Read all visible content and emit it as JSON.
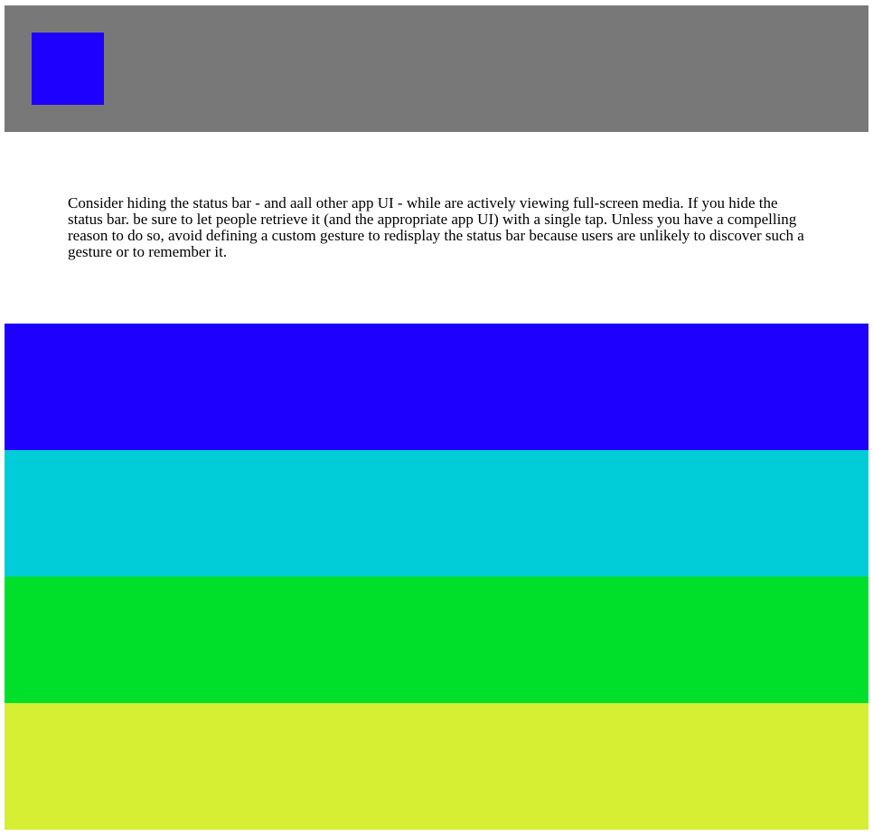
{
  "header": {
    "logo_color": "#1e00ff",
    "background_color": "#787878"
  },
  "content": {
    "paragraph": "Consider hiding the status bar - and aall other app UI - while are actively viewing full-screen media. If you hide the status bar. be sure to let people retrieve it (and the appropriate app UI) with a single tap. Unless you have a compelling reason to do so, avoid defining a custom gesture to redisplay the status bar because users are unlikely to discover such a gesture or to remember it."
  },
  "bands": [
    {
      "color": "#1e00ff"
    },
    {
      "color": "#00cdd8"
    },
    {
      "color": "#00e02a"
    },
    {
      "color": "#d6ef32"
    }
  ]
}
